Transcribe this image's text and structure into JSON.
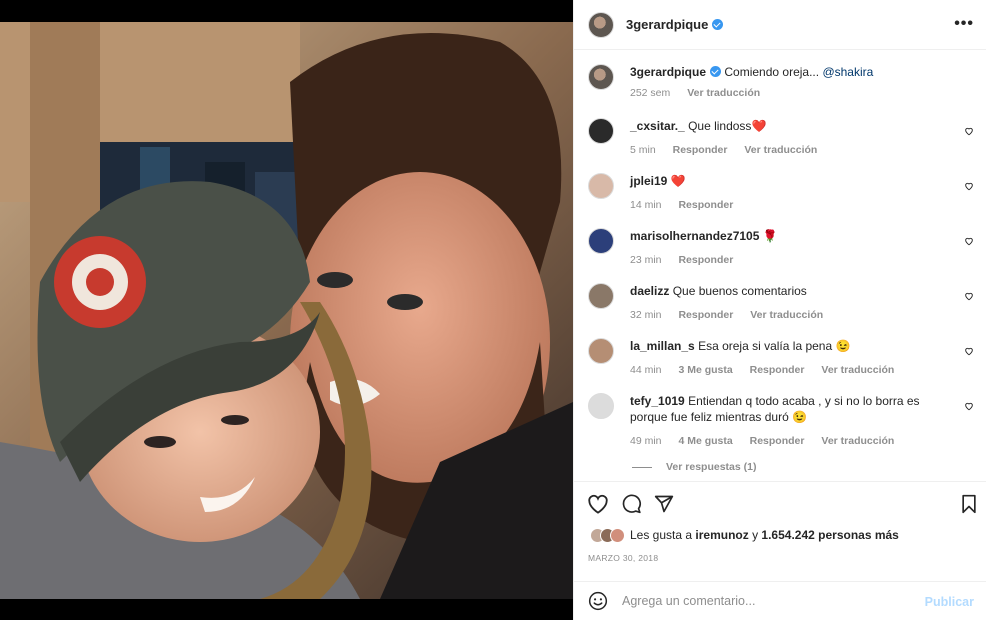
{
  "post": {
    "username": "3gerardpique",
    "caption_text": "Comiendo oreja...",
    "caption_mention": "@shakira",
    "caption_time": "252 sem",
    "caption_translate": "Ver traducción"
  },
  "comments": [
    {
      "user": "_cxsitar._",
      "text": "Que lindoss",
      "emoji": "❤️",
      "time": "5 min",
      "likes": "",
      "reply": "Responder",
      "translate": "Ver traducción"
    },
    {
      "user": "jplei19",
      "text": "",
      "emoji": "❤️",
      "time": "14 min",
      "likes": "",
      "reply": "Responder",
      "translate": ""
    },
    {
      "user": "marisolhernandez7105",
      "text": "",
      "emoji": "🌹",
      "time": "23 min",
      "likes": "",
      "reply": "Responder",
      "translate": ""
    },
    {
      "user": "daelizz",
      "text": "Que buenos comentarios",
      "emoji": "",
      "time": "32 min",
      "likes": "",
      "reply": "Responder",
      "translate": "Ver traducción"
    },
    {
      "user": "la_millan_s",
      "text": "Esa oreja si valía la pena",
      "emoji": "😉",
      "time": "44 min",
      "likes": "3 Me gusta",
      "reply": "Responder",
      "translate": "Ver traducción"
    },
    {
      "user": "tefy_1019",
      "text": "Entiendan q todo acaba , y si no lo borra es porque fue feliz mientras duró",
      "emoji": "😉",
      "time": "49 min",
      "likes": "4 Me gusta",
      "reply": "Responder",
      "translate": "Ver traducción"
    }
  ],
  "view_replies": "Ver respuestas (1)",
  "likes": {
    "prefix": "Les gusta a",
    "user": "iremunoz",
    "joiner": "y",
    "count": "1.654.242 personas más"
  },
  "date": "MARZO 30, 2018",
  "add_comment": {
    "placeholder": "Agrega un comentario...",
    "publish": "Publicar"
  },
  "colors": {
    "verified": "#3897f0",
    "mention": "#00376b",
    "publish": "#b3dbff",
    "heart": "#e0245e"
  }
}
